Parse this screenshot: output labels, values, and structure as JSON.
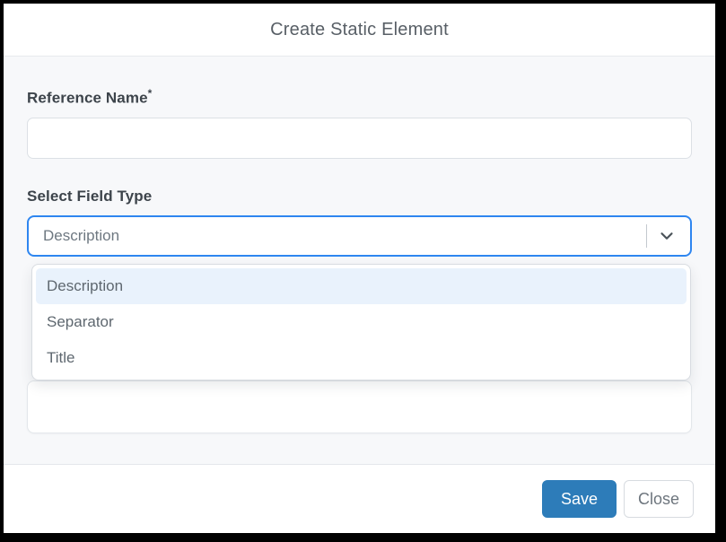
{
  "modal": {
    "title": "Create Static Element",
    "fields": {
      "reference_name": {
        "label": "Reference Name",
        "required_marker": "*",
        "value": "",
        "placeholder": ""
      },
      "field_type": {
        "label": "Select Field Type",
        "selected_value": "Description",
        "options": [
          "Description",
          "Separator",
          "Title"
        ],
        "highlighted_option": "Description"
      },
      "description": {
        "value": ""
      }
    },
    "footer": {
      "save_label": "Save",
      "close_label": "Close"
    }
  },
  "icons": {
    "chevron_down": "chevron-down-icon"
  },
  "colors": {
    "focus_blue": "#2e86f0",
    "save_blue": "#2d7cb9",
    "option_highlight": "#e9f2fc",
    "body_gray": "#f7f8fa",
    "label_color": "#3d444b",
    "muted_text": "#6e7881"
  }
}
